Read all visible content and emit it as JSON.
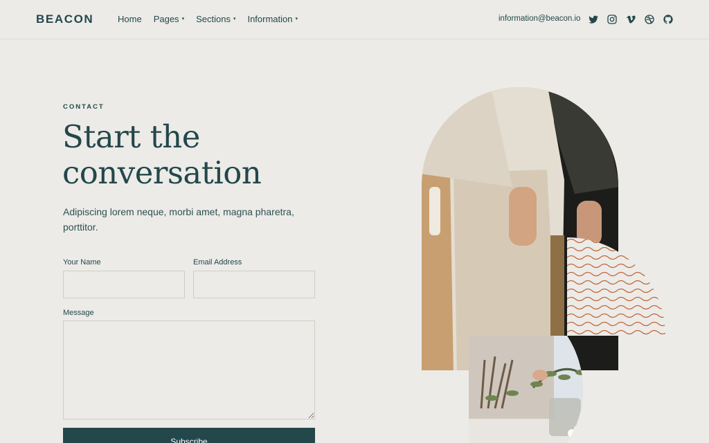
{
  "header": {
    "brand": "BEACON",
    "nav": [
      {
        "label": "Home",
        "has_dropdown": false
      },
      {
        "label": "Pages",
        "has_dropdown": true
      },
      {
        "label": "Sections",
        "has_dropdown": true
      },
      {
        "label": "Information",
        "has_dropdown": true
      }
    ],
    "dropdown_glyph": "▾",
    "email": "information@beacon.io",
    "socials": [
      "twitter-icon",
      "instagram-icon",
      "vimeo-icon",
      "dribbble-icon",
      "github-icon"
    ]
  },
  "hero": {
    "eyebrow": "CONTACT",
    "title": "Start the conversation",
    "lead": "Adipiscing lorem neque, morbi amet, magna pharetra, porttitor."
  },
  "form": {
    "name_label": "Your Name",
    "name_value": "",
    "email_label": "Email Address",
    "email_value": "",
    "message_label": "Message",
    "message_value": "",
    "submit_label": "Subscribe"
  },
  "colors": {
    "background": "#ecebe7",
    "primary": "#23474b",
    "accent_waves": "#c0673a"
  }
}
